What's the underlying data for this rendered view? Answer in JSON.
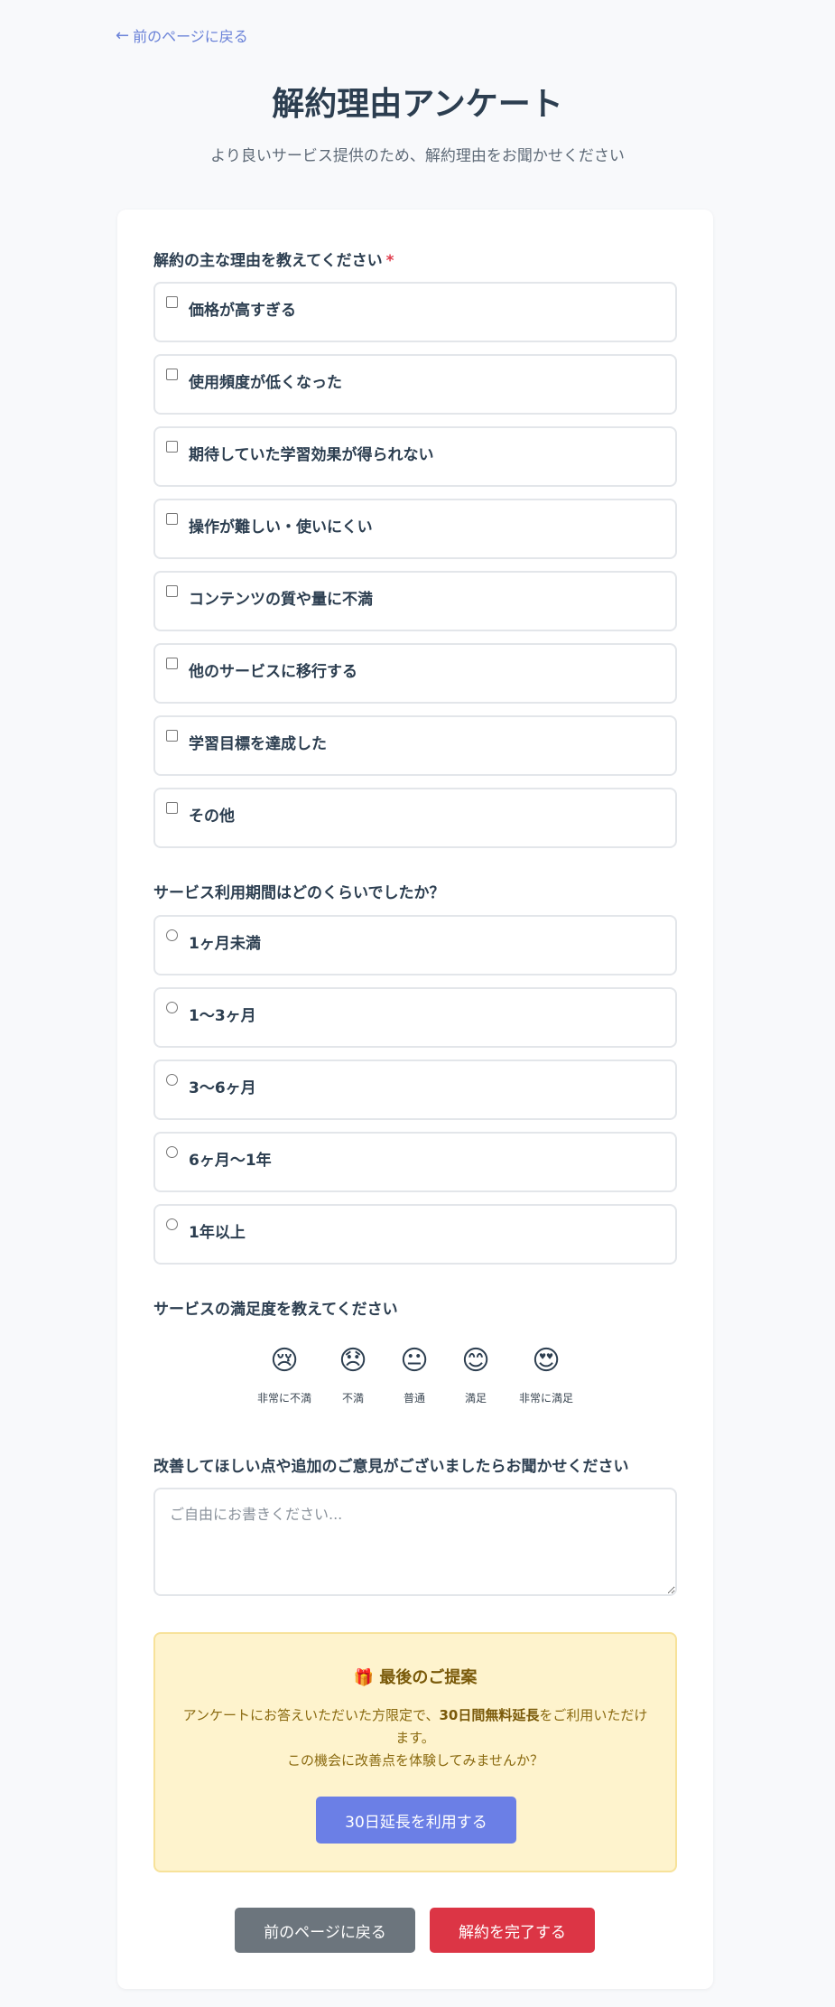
{
  "back_link": {
    "arrow": "←",
    "label": "前のページに戻る"
  },
  "header": {
    "title": "解約理由アンケート",
    "subtitle": "より良いサービス提供のため、解約理由をお聞かせください"
  },
  "reasons": {
    "label": "解約の主な理由を教えてください",
    "required_mark": "*",
    "options": [
      "価格が高すぎる",
      "使用頻度が低くなった",
      "期待していた学習効果が得られない",
      "操作が難しい・使いにくい",
      "コンテンツの質や量に不満",
      "他のサービスに移行する",
      "学習目標を達成した",
      "その他"
    ]
  },
  "period": {
    "label": "サービス利用期間はどのくらいでしたか？",
    "options": [
      "1ヶ月未満",
      "1〜3ヶ月",
      "3〜6ヶ月",
      "6ヶ月〜1年",
      "1年以上"
    ]
  },
  "satisfaction": {
    "label": "サービスの満足度を教えてください",
    "items": [
      {
        "emoji": "😢",
        "label": "非常に不満"
      },
      {
        "emoji": "😞",
        "label": "不満"
      },
      {
        "emoji": "😐",
        "label": "普通"
      },
      {
        "emoji": "😊",
        "label": "満足"
      },
      {
        "emoji": "😍",
        "label": "非常に満足"
      }
    ]
  },
  "feedback": {
    "label": "改善してほしい点や追加のご意見がございましたらお聞かせください",
    "placeholder": "ご自由にお書きください...",
    "value": ""
  },
  "offer": {
    "icon": "🎁",
    "title": "最後のご提案",
    "line1_pre": "アンケートにお答えいただいた方限定で、",
    "line1_bold": "30日間無料延長",
    "line1_post": "をご利用いただけます。",
    "line2": "この機会に改善点を体験してみませんか？",
    "button": "30日延長を利用する"
  },
  "actions": {
    "back": "前のページに戻る",
    "submit": "解約を完了する"
  },
  "colors": {
    "accent": "#6b7fe6",
    "danger": "#dc3545",
    "secondary": "#6c757d",
    "offer_bg": "#fef3cd",
    "link": "#6a82d8"
  }
}
